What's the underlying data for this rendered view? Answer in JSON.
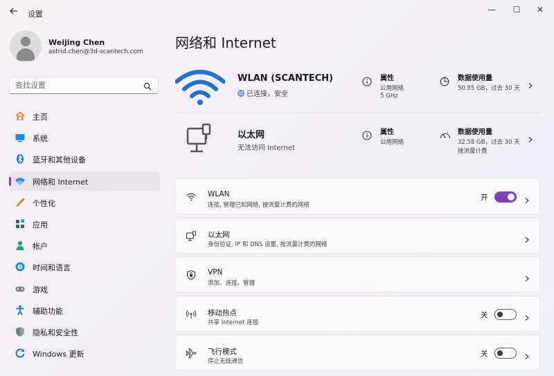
{
  "window": {
    "title": "设置",
    "controls": {
      "minimize": "—",
      "maximize": "☐",
      "close": "✕"
    }
  },
  "profile": {
    "name": "Weijing Chen",
    "email": "astrid.chen@3d-scantech.com"
  },
  "search": {
    "placeholder": "查找设置"
  },
  "sidebar": {
    "items": [
      {
        "label": "主页",
        "icon": "home-icon"
      },
      {
        "label": "系统",
        "icon": "system-icon"
      },
      {
        "label": "蓝牙和其他设备",
        "icon": "bluetooth-icon"
      },
      {
        "label": "网络和 Internet",
        "icon": "network-icon",
        "active": true
      },
      {
        "label": "个性化",
        "icon": "brush-icon"
      },
      {
        "label": "应用",
        "icon": "apps-icon"
      },
      {
        "label": "帐户",
        "icon": "account-icon"
      },
      {
        "label": "时间和语言",
        "icon": "time-language-icon"
      },
      {
        "label": "游戏",
        "icon": "gaming-icon"
      },
      {
        "label": "辅助功能",
        "icon": "accessibility-icon"
      },
      {
        "label": "隐私和安全性",
        "icon": "shield-icon"
      },
      {
        "label": "Windows 更新",
        "icon": "update-icon"
      }
    ]
  },
  "main": {
    "title": "网络和 Internet",
    "wlan_summary": {
      "name": "WLAN (SCANTECH)",
      "status": "已连接，安全",
      "properties": {
        "title": "属性",
        "line1": "公用网络",
        "line2": "5 GHz"
      },
      "usage": {
        "title": "数据使用量",
        "line1": "50.85 GB，过去 30 天"
      }
    },
    "ethernet_summary": {
      "name": "以太网",
      "status": "无法访问 Internet",
      "properties": {
        "title": "属性",
        "line1": "公用网络"
      },
      "usage": {
        "title": "数据使用量",
        "line1": "32.58 GB，过去 30 天",
        "line2": "按流量计费"
      }
    },
    "cards": [
      {
        "title": "WLAN",
        "subtitle": "连接, 管理已知网络, 按流量计费的网络",
        "toggle_label": "开",
        "toggle_on": true,
        "icon": "wifi-icon"
      },
      {
        "title": "以太网",
        "subtitle": "身份验证, IP 和 DNS 设置, 按流量计费的网络",
        "icon": "ethernet-icon"
      },
      {
        "title": "VPN",
        "subtitle": "添加、连接、管理",
        "icon": "vpn-shield-icon"
      },
      {
        "title": "移动热点",
        "subtitle": "共享 Internet 连接",
        "toggle_label": "关",
        "toggle_on": false,
        "icon": "hotspot-icon"
      },
      {
        "title": "飞行模式",
        "subtitle": "停止无线通信",
        "toggle_label": "关",
        "toggle_on": false,
        "icon": "airplane-icon"
      }
    ]
  },
  "colors": {
    "accent": "#7f3fbf",
    "wifi_blue": "#1c72d6"
  }
}
